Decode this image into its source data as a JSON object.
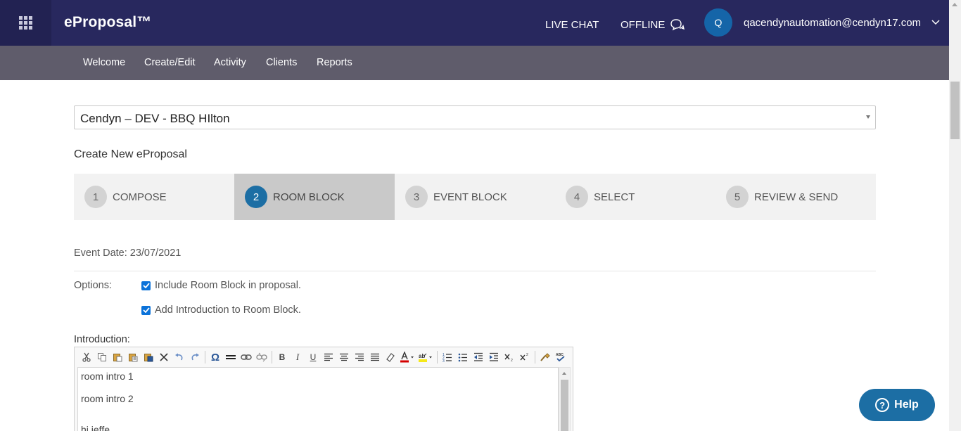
{
  "header": {
    "brand": "eProposal™",
    "live_chat": "LIVE CHAT",
    "offline": "OFFLINE",
    "avatar_initial": "Q",
    "user_email": "qacendynautomation@cendyn17.com"
  },
  "nav": {
    "items": [
      {
        "label": "Welcome"
      },
      {
        "label": "Create/Edit"
      },
      {
        "label": "Activity"
      },
      {
        "label": "Clients"
      },
      {
        "label": "Reports"
      }
    ]
  },
  "property_select": {
    "value": "Cendyn – DEV - BBQ HIlton"
  },
  "page": {
    "heading": "Create New eProposal"
  },
  "steps": [
    {
      "number": "1",
      "label": "COMPOSE",
      "active": false
    },
    {
      "number": "2",
      "label": "ROOM BLOCK",
      "active": true
    },
    {
      "number": "3",
      "label": "EVENT BLOCK",
      "active": false
    },
    {
      "number": "4",
      "label": "SELECT",
      "active": false
    },
    {
      "number": "5",
      "label": "REVIEW & SEND",
      "active": false
    }
  ],
  "event_date": {
    "label": "Event Date:",
    "value": "23/07/2021"
  },
  "options": {
    "label": "Options:",
    "items": [
      {
        "label": "Include Room Block in proposal.",
        "checked": true
      },
      {
        "label": "Add Introduction to Room Block.",
        "checked": true
      }
    ]
  },
  "introduction": {
    "label": "Introduction:",
    "lines": [
      "room intro 1",
      "room intro 2",
      "hi jeffe"
    ]
  },
  "toolbar_icons": [
    "cut-icon",
    "copy-icon",
    "paste-icon",
    "paste-text-icon",
    "paste-word-icon",
    "remove-format-icon",
    "undo-icon",
    "redo-icon",
    "special-char-icon",
    "horizontal-line-icon",
    "link-icon",
    "unlink-icon",
    "bold-icon",
    "italic-icon",
    "underline-icon",
    "align-left-icon",
    "align-center-icon",
    "align-right-icon",
    "justify-icon",
    "eraser-icon",
    "text-color-icon",
    "highlight-color-icon",
    "ordered-list-icon",
    "unordered-list-icon",
    "outdent-icon",
    "indent-icon",
    "subscript-icon",
    "superscript-icon",
    "clean-icon",
    "spellcheck-icon"
  ],
  "help": {
    "label": "Help"
  },
  "colors": {
    "header_bg": "#28285e",
    "nav_bg": "#5f5c6b",
    "accent": "#1c6ea4",
    "active_step_bg": "#c9c9c9",
    "checkbox": "#0b72d9"
  }
}
